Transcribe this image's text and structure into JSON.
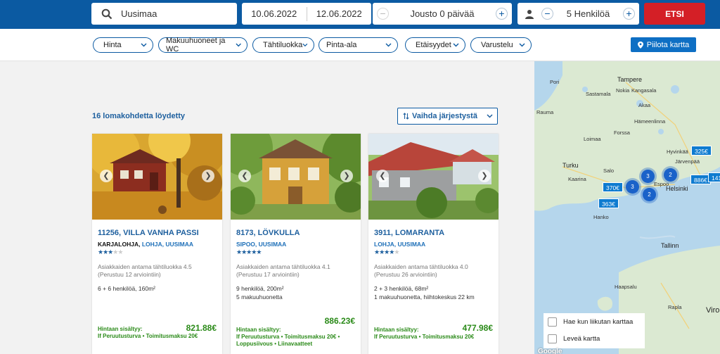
{
  "search": {
    "location": "Uusimaa",
    "date_start": "10.06.2022",
    "date_end": "12.06.2022",
    "flex_label": "Jousto 0 päivää",
    "persons_label": "5 Henkilöä",
    "search_button": "ETSI"
  },
  "filters": [
    {
      "label": "Hinta"
    },
    {
      "label": "Makuuhuoneet ja WC"
    },
    {
      "label": "Tähtiluokka"
    },
    {
      "label": "Pinta-ala"
    },
    {
      "label": "Etäisyydet"
    },
    {
      "label": "Varustelu"
    }
  ],
  "hide_map_button": "Piilota kartta",
  "results": {
    "count_label": "16 lomakohdetta löydetty",
    "sort_label": "Vaihda järjestystä"
  },
  "cards": [
    {
      "title": "11256, VILLA VANHA PASSI",
      "municipality": "KARJALOHJA,",
      "region": " LOHJA, UUSIMAA",
      "stars": 3,
      "rating_text": "Asiakkaiden antama tähtiluokka 4.5",
      "rating_basis": "(Perustuu 12 arviointiin)",
      "capacity": "6 + 6 henkilöä, 160m²",
      "details": "",
      "price": "821.88€",
      "includes_title": "Hintaan sisältyy:",
      "includes": "If Peruutusturva • Toimitusmaksu 20€",
      "includes_more": ""
    },
    {
      "title": "8173, LÖVKULLA",
      "municipality": "",
      "region": "SIPOO, UUSIMAA",
      "stars": 5,
      "rating_text": "Asiakkaiden antama tähtiluokka 4.1",
      "rating_basis": "(Perustuu 17 arviointiin)",
      "capacity": "9 henkilöä, 200m²",
      "details": "5 makuuhuonetta",
      "price": "886.23€",
      "includes_title": "Hintaan sisältyy:",
      "includes": "If Peruutusturva • Toimitusmaksu 20€ •",
      "includes_more": "Loppusiivous • Liinavaatteet"
    },
    {
      "title": "3911, LOMARANTA",
      "municipality": "",
      "region": "LOHJA, UUSIMAA",
      "stars": 4,
      "rating_text": "Asiakkaiden antama tähtiluokka 4.0",
      "rating_basis": "(Perustuu 26 arviointiin)",
      "capacity": "2 + 3 henkilöä, 68m²",
      "details": "1 makuuhuonetta, hiihtokeskus 22 km",
      "price": "477.98€",
      "includes_title": "Hintaan sisältyy:",
      "includes": "If Peruutusturva • Toimitusmaksu 20€",
      "includes_more": ""
    }
  ],
  "map": {
    "labels": [
      "Pori",
      "Tampere",
      "Nokia",
      "Kangasala",
      "Sastamala",
      "Akaa",
      "Rauma",
      "Hämeenlinna",
      "Forssa",
      "Loimaa",
      "Hyvinkää",
      "Järvenpää",
      "Turku",
      "Kaarina",
      "Salo",
      "Helsinki",
      "Espoo",
      "Hanko",
      "Tallinn",
      "Haapsalu",
      "Rapla",
      "Viro"
    ],
    "price_tags": [
      "325€",
      "886€",
      "141",
      "370€",
      "363€"
    ],
    "clusters": [
      "3",
      "2",
      "3",
      "2"
    ],
    "option_move": "Hae kun liikutan karttaa",
    "option_wide": "Leveä kartta",
    "attribution": "Google"
  },
  "colors": {
    "brand": "#0b5aa2",
    "search_button": "#d41f26",
    "price": "#2a8a18",
    "link": "#1d5f9e"
  }
}
